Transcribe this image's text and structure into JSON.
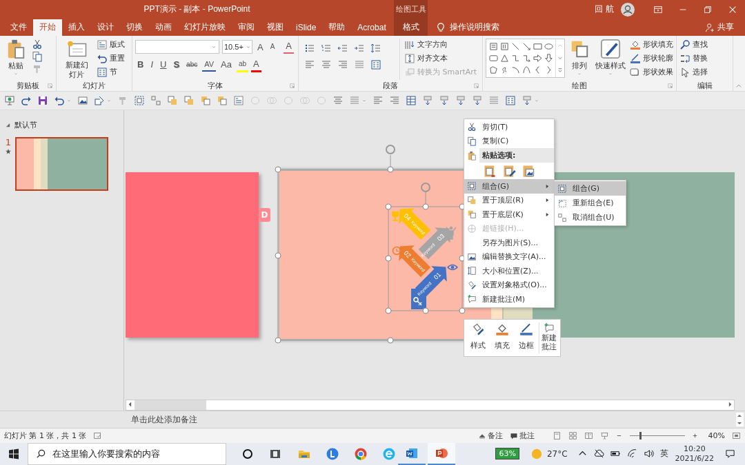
{
  "window": {
    "title": "PPT演示 - 副本  -  PowerPoint",
    "tool_group": "绘图工具",
    "user": "回 航"
  },
  "tabs": [
    {
      "label": "文件",
      "selected": false,
      "kind": "normal"
    },
    {
      "label": "开始",
      "selected": true,
      "kind": "normal"
    },
    {
      "label": "插入",
      "selected": false,
      "kind": "normal"
    },
    {
      "label": "设计",
      "selected": false,
      "kind": "normal"
    },
    {
      "label": "切换",
      "selected": false,
      "kind": "normal"
    },
    {
      "label": "动画",
      "selected": false,
      "kind": "normal"
    },
    {
      "label": "幻灯片放映",
      "selected": false,
      "kind": "normal"
    },
    {
      "label": "审阅",
      "selected": false,
      "kind": "normal"
    },
    {
      "label": "视图",
      "selected": false,
      "kind": "normal"
    },
    {
      "label": "iSlide",
      "selected": false,
      "kind": "normal"
    },
    {
      "label": "帮助",
      "selected": false,
      "kind": "normal"
    },
    {
      "label": "Acrobat",
      "selected": false,
      "kind": "normal"
    },
    {
      "label": "格式",
      "selected": false,
      "kind": "context"
    }
  ],
  "tell_me": "操作说明搜索",
  "share": "共享",
  "ribbon": {
    "clipboard": {
      "label": "剪贴板",
      "paste": "粘贴"
    },
    "slides": {
      "label": "幻灯片",
      "new_slide": "新建幻灯片",
      "items": [
        "版式",
        "重置",
        "节"
      ]
    },
    "font": {
      "label": "字体",
      "font_size": "10.5+",
      "size_buttons": [
        "A",
        "A"
      ],
      "clear_format": "A",
      "format_buttons": [
        "B",
        "I",
        "U",
        "S",
        "abc",
        "AV",
        "Aa"
      ],
      "highlight": "ab",
      "font_color": "A"
    },
    "paragraph": {
      "label": "段落",
      "items": [
        {
          "label": "文字方向",
          "disabled": false
        },
        {
          "label": "对齐文本",
          "disabled": false
        },
        {
          "label": "转换为 SmartArt",
          "disabled": true
        }
      ]
    },
    "drawing": {
      "label": "绘图",
      "arrange": "排列",
      "quick_styles": "快速样式",
      "items": [
        "形状填充",
        "形状轮廓",
        "形状效果"
      ]
    },
    "editing": {
      "label": "编辑",
      "items": [
        "查找",
        "替换",
        "选择"
      ]
    }
  },
  "slides_panel": {
    "section": "默认节",
    "slides": [
      {
        "number": "1",
        "selected": true
      }
    ]
  },
  "slide": {
    "tab_letter": "D",
    "steps": [
      {
        "number": "04",
        "label": "Keyword",
        "color": "#ffc000"
      },
      {
        "number": "03",
        "label": "Keyword",
        "color": "#a5a5a5"
      },
      {
        "number": "02",
        "label": "Keyword",
        "color": "#ed7d31"
      },
      {
        "number": "01",
        "label": "Keyword",
        "color": "#4472c4"
      }
    ]
  },
  "context_menu": {
    "items": [
      {
        "kind": "item",
        "label": "剪切(T)",
        "disabled": false,
        "selected": false,
        "submenu": false
      },
      {
        "kind": "item",
        "label": "复制(C)",
        "disabled": false,
        "selected": false,
        "submenu": false
      },
      {
        "kind": "header",
        "label": "粘贴选项:"
      },
      {
        "kind": "paste-options"
      },
      {
        "kind": "item",
        "label": "组合(G)",
        "disabled": false,
        "selected": true,
        "submenu": true
      },
      {
        "kind": "item",
        "label": "置于顶层(R)",
        "disabled": false,
        "selected": false,
        "submenu": true
      },
      {
        "kind": "item",
        "label": "置于底层(K)",
        "disabled": false,
        "selected": false,
        "submenu": true
      },
      {
        "kind": "item",
        "label": "超链接(H)...",
        "disabled": true,
        "selected": false,
        "submenu": false
      },
      {
        "kind": "item",
        "label": "另存为图片(S)...",
        "disabled": false,
        "selected": false,
        "submenu": false
      },
      {
        "kind": "item",
        "label": "编辑替换文字(A)...",
        "disabled": false,
        "selected": false,
        "submenu": false
      },
      {
        "kind": "item",
        "label": "大小和位置(Z)...",
        "disabled": false,
        "selected": false,
        "submenu": false
      },
      {
        "kind": "item",
        "label": "设置对象格式(O)...",
        "disabled": false,
        "selected": false,
        "submenu": false
      },
      {
        "kind": "item",
        "label": "新建批注(M)",
        "disabled": false,
        "selected": false,
        "submenu": false
      }
    ]
  },
  "submenu": {
    "items": [
      {
        "label": "组合(G)",
        "selected": true
      },
      {
        "label": "重新组合(E)",
        "selected": false
      },
      {
        "label": "取消组合(U)",
        "selected": false
      }
    ]
  },
  "mini_toolbar": {
    "buttons": [
      "样式",
      "填充",
      "边框",
      "新建批注"
    ]
  },
  "notes": {
    "placeholder": "单击此处添加备注"
  },
  "status_bar": {
    "slide_info": "幻灯片 第 1 张，共 1 张",
    "notes": "备注",
    "comments": "批注",
    "zoom": "40%",
    "zoom_slider": {
      "level": 0.18
    }
  },
  "taskbar": {
    "search_placeholder": "在这里输入你要搜索的内容",
    "battery": "63%",
    "temperature": "27°C",
    "ime": "英",
    "time": "10:20",
    "date": "2021/6/22"
  }
}
